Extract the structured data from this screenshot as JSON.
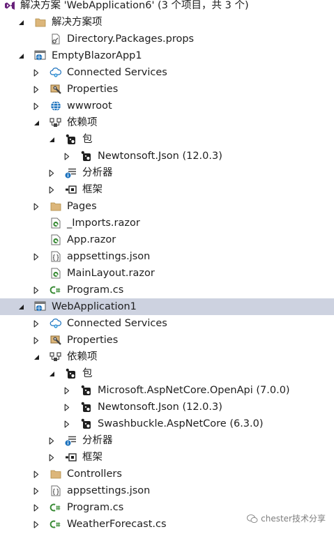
{
  "solution_explorer": {
    "rows": [
      {
        "indent": 0,
        "arrow": "none",
        "icon": "solution-icon",
        "label": "解决方案 'WebApplication6' (3 个项目，共 3 个)"
      },
      {
        "indent": 1,
        "arrow": "expanded",
        "icon": "folder-icon",
        "label": "解决方案项"
      },
      {
        "indent": 2,
        "arrow": "none",
        "icon": "props-file-icon",
        "label": "Directory.Packages.props"
      },
      {
        "indent": 1,
        "arrow": "expanded",
        "icon": "web-project-icon",
        "label": "EmptyBlazorApp1"
      },
      {
        "indent": 2,
        "arrow": "collapsed",
        "icon": "connected-services-icon",
        "label": "Connected Services"
      },
      {
        "indent": 2,
        "arrow": "collapsed",
        "icon": "properties-icon",
        "label": "Properties"
      },
      {
        "indent": 2,
        "arrow": "collapsed",
        "icon": "globe-icon",
        "label": "wwwroot"
      },
      {
        "indent": 2,
        "arrow": "expanded",
        "icon": "dependencies-icon",
        "label": "依赖项"
      },
      {
        "indent": 3,
        "arrow": "expanded",
        "icon": "package-icon",
        "label": "包"
      },
      {
        "indent": 4,
        "arrow": "collapsed",
        "icon": "package-icon",
        "label": "Newtonsoft.Json (12.0.3)"
      },
      {
        "indent": 3,
        "arrow": "collapsed",
        "icon": "analyzer-icon",
        "label": "分析器"
      },
      {
        "indent": 3,
        "arrow": "collapsed",
        "icon": "framework-icon",
        "label": "框架"
      },
      {
        "indent": 2,
        "arrow": "collapsed",
        "icon": "folder-icon",
        "label": "Pages"
      },
      {
        "indent": 2,
        "arrow": "none",
        "icon": "razor-file-icon",
        "label": "_Imports.razor"
      },
      {
        "indent": 2,
        "arrow": "none",
        "icon": "razor-file-icon",
        "label": "App.razor"
      },
      {
        "indent": 2,
        "arrow": "collapsed",
        "icon": "json-file-icon",
        "label": "appsettings.json"
      },
      {
        "indent": 2,
        "arrow": "none",
        "icon": "razor-file-icon",
        "label": "MainLayout.razor"
      },
      {
        "indent": 2,
        "arrow": "collapsed",
        "icon": "csharp-file-icon",
        "label": "Program.cs"
      },
      {
        "indent": 1,
        "arrow": "expanded",
        "icon": "web-project-icon",
        "label": "WebApplication1",
        "selected": true
      },
      {
        "indent": 2,
        "arrow": "collapsed",
        "icon": "connected-services-icon",
        "label": "Connected Services"
      },
      {
        "indent": 2,
        "arrow": "collapsed",
        "icon": "properties-icon",
        "label": "Properties"
      },
      {
        "indent": 2,
        "arrow": "expanded",
        "icon": "dependencies-icon",
        "label": "依赖项"
      },
      {
        "indent": 3,
        "arrow": "expanded",
        "icon": "package-icon",
        "label": "包"
      },
      {
        "indent": 4,
        "arrow": "collapsed",
        "icon": "package-icon",
        "label": "Microsoft.AspNetCore.OpenApi (7.0.0)"
      },
      {
        "indent": 4,
        "arrow": "collapsed",
        "icon": "package-icon",
        "label": "Newtonsoft.Json (12.0.3)"
      },
      {
        "indent": 4,
        "arrow": "collapsed",
        "icon": "package-icon",
        "label": "Swashbuckle.AspNetCore (6.3.0)"
      },
      {
        "indent": 3,
        "arrow": "collapsed",
        "icon": "analyzer-icon",
        "label": "分析器"
      },
      {
        "indent": 3,
        "arrow": "collapsed",
        "icon": "framework-icon",
        "label": "框架"
      },
      {
        "indent": 2,
        "arrow": "collapsed",
        "icon": "folder-icon",
        "label": "Controllers"
      },
      {
        "indent": 2,
        "arrow": "collapsed",
        "icon": "json-file-icon",
        "label": "appsettings.json"
      },
      {
        "indent": 2,
        "arrow": "collapsed",
        "icon": "csharp-file-icon",
        "label": "Program.cs"
      },
      {
        "indent": 2,
        "arrow": "collapsed",
        "icon": "csharp-file-icon",
        "label": "WeatherForecast.cs"
      }
    ]
  },
  "watermark": {
    "text": "chester技术分享"
  },
  "colors": {
    "selection": "#cdd2e0",
    "text": "#1e1e1e",
    "folder": "#dcb67a",
    "vs_purple": "#68217a",
    "csharp_green": "#388a34",
    "web_blue": "#1e73be"
  }
}
